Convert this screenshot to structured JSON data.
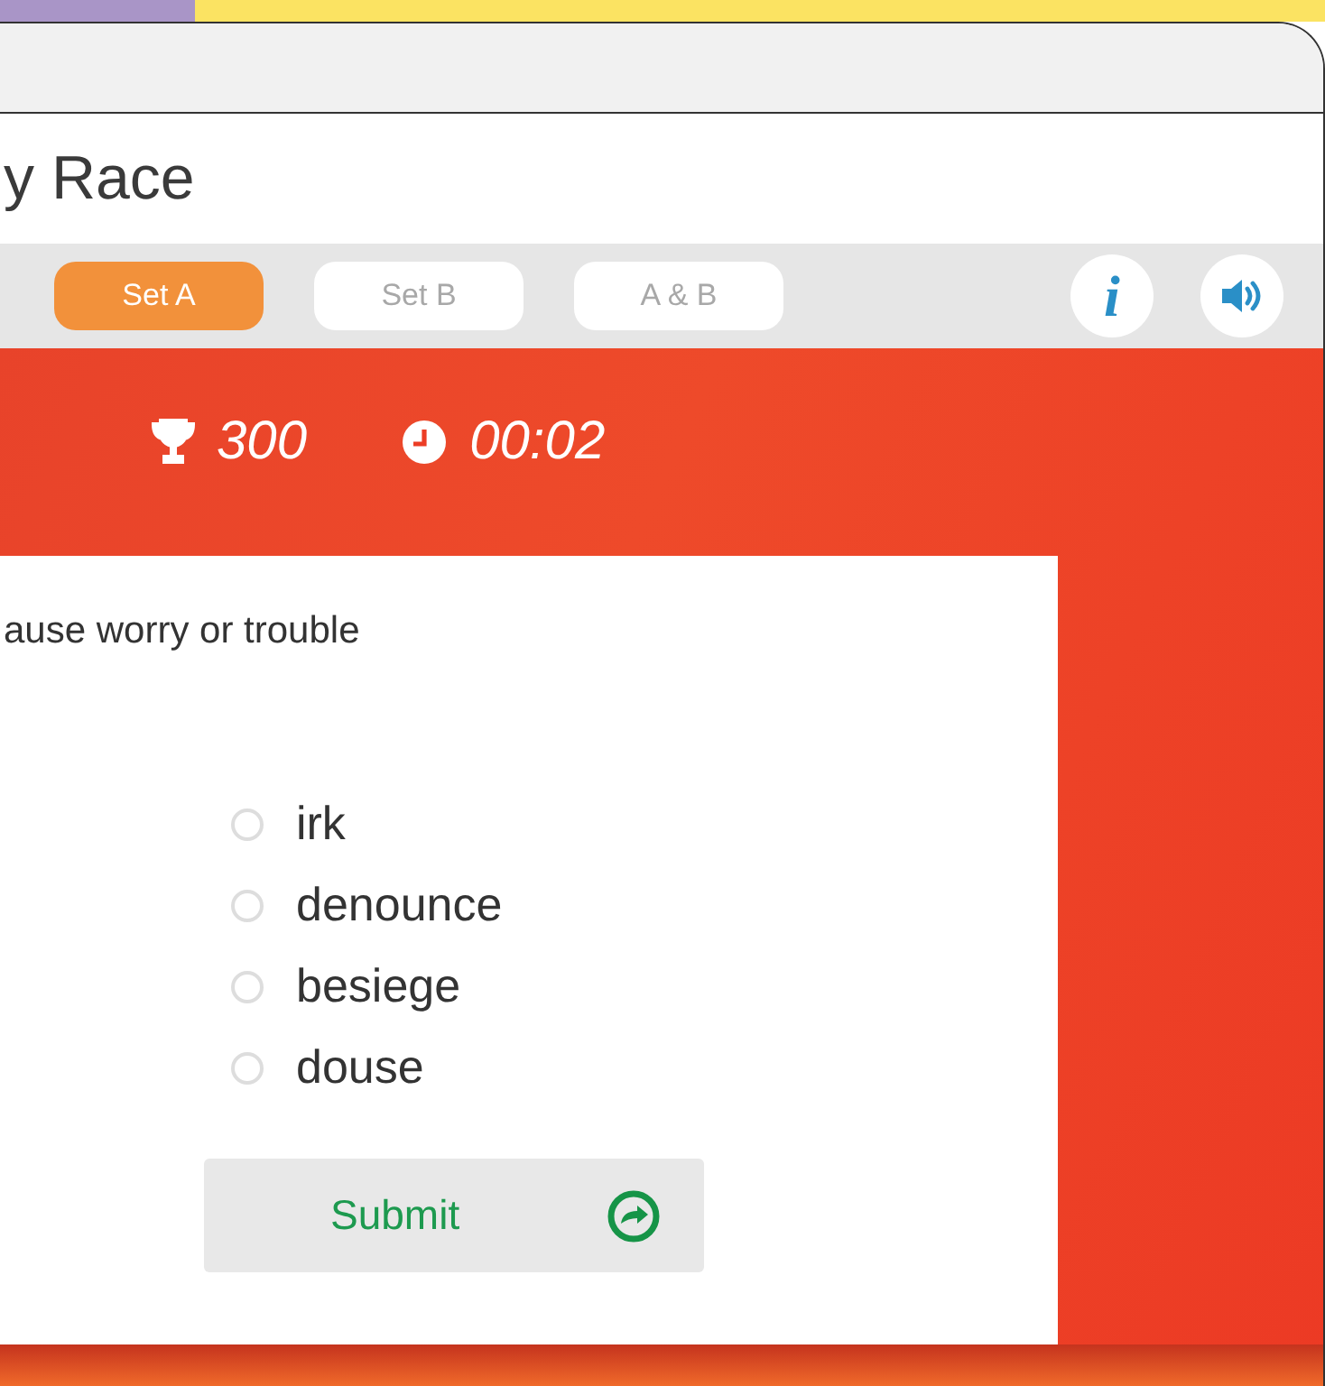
{
  "title": "y Race",
  "tabs": [
    {
      "label": "Set A",
      "selected": true
    },
    {
      "label": "Set B",
      "selected": false
    },
    {
      "label": "A & B",
      "selected": false
    }
  ],
  "info_icon": "i",
  "score": "300",
  "time": "00:02",
  "question": "ause worry or trouble",
  "options": [
    {
      "label": "irk",
      "selected": false
    },
    {
      "label": "denounce",
      "selected": false
    },
    {
      "label": "besiege",
      "selected": false
    },
    {
      "label": "douse",
      "selected": false
    }
  ],
  "submit": "Submit"
}
